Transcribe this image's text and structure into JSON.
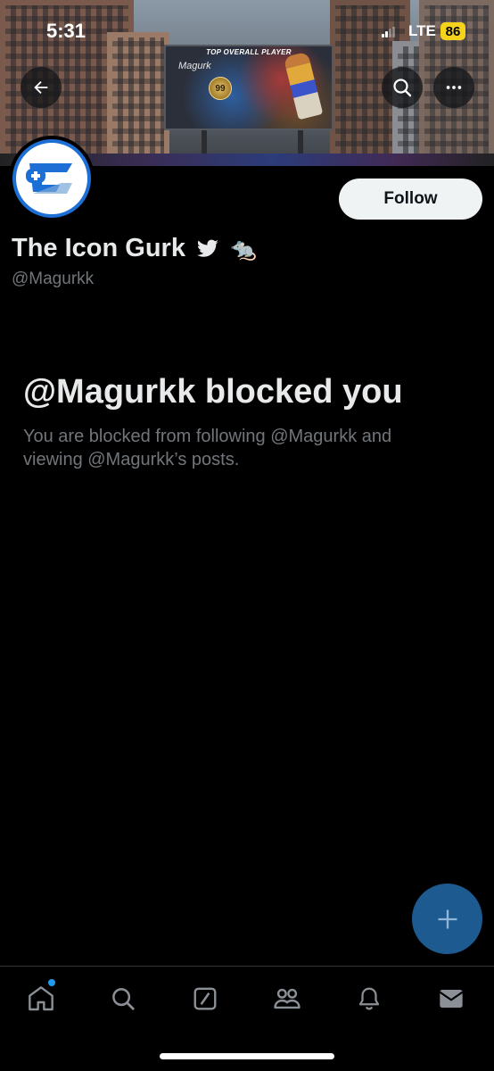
{
  "status_bar": {
    "time": "5:31",
    "network": "LTE",
    "battery": "86",
    "battery_color": "#f5d21b"
  },
  "banner": {
    "billboard_heading": "TOP OVERALL PLAYER",
    "billboard_name": "Magurk",
    "billboard_rating": "99"
  },
  "header": {
    "back_icon": "arrow-left-icon",
    "search_icon": "search-icon",
    "more_icon": "more-horizontal-icon"
  },
  "profile": {
    "display_name": "The Icon Gurk",
    "name_emojis": [
      "bird-icon",
      "rat-emoji"
    ],
    "rat_emoji": "🐀",
    "handle": "@Magurkk",
    "follow_label": "Follow",
    "avatar_ring_color": "#1d6fd6"
  },
  "blocked": {
    "title": "@Magurkk blocked you",
    "message": "You are blocked from following @Magurkk and viewing @Magurkk’s posts."
  },
  "fab": {
    "icon": "plus-icon",
    "color": "#1d5a8f"
  },
  "bottom_nav": {
    "items": [
      "home-icon",
      "search-icon",
      "grok-icon",
      "communities-icon",
      "notifications-icon",
      "messages-icon"
    ],
    "home_notification_dot_color": "#1d9bf0"
  }
}
